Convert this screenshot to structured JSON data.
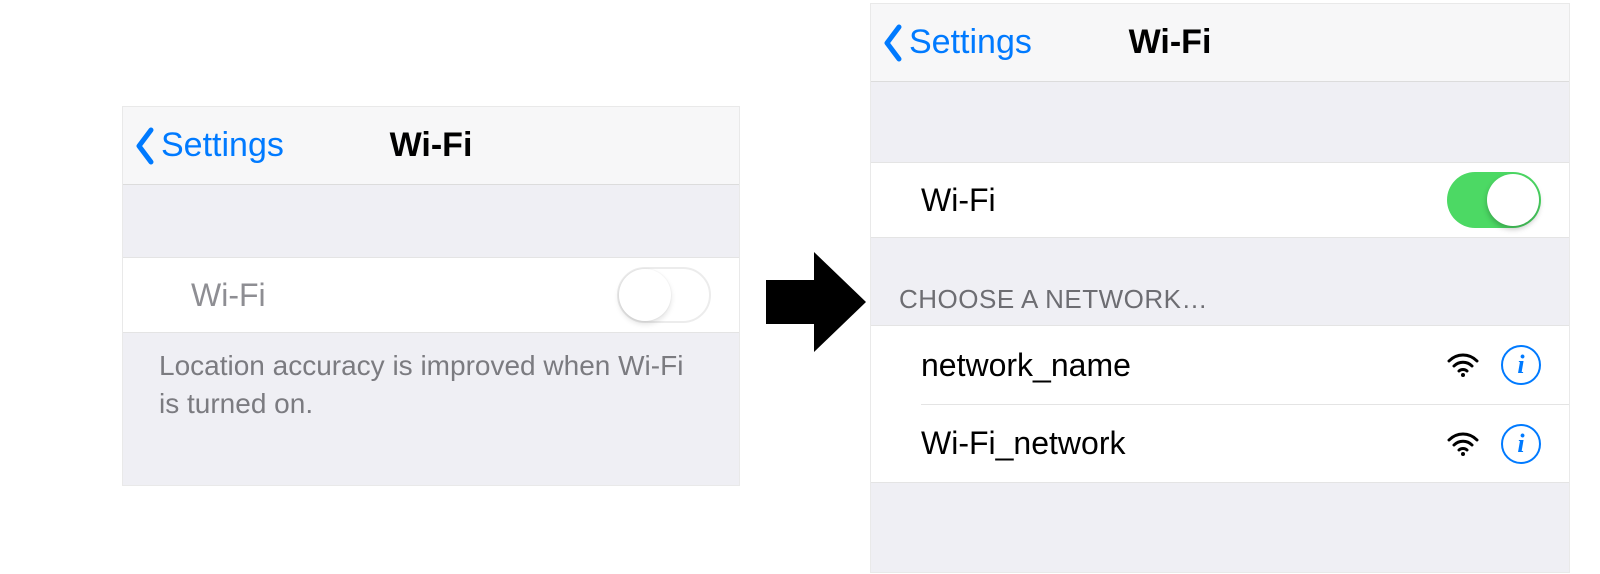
{
  "left": {
    "back_label": "Settings",
    "title": "Wi-Fi",
    "toggle_label": "Wi-Fi",
    "footer_text": "Location accuracy is improved when Wi-Fi is turned on."
  },
  "right": {
    "back_label": "Settings",
    "title": "Wi-Fi",
    "toggle_label": "Wi-Fi",
    "section_header": "CHOOSE A NETWORK…",
    "networks": [
      {
        "name": "network_name"
      },
      {
        "name": "Wi-Fi_network"
      }
    ]
  }
}
